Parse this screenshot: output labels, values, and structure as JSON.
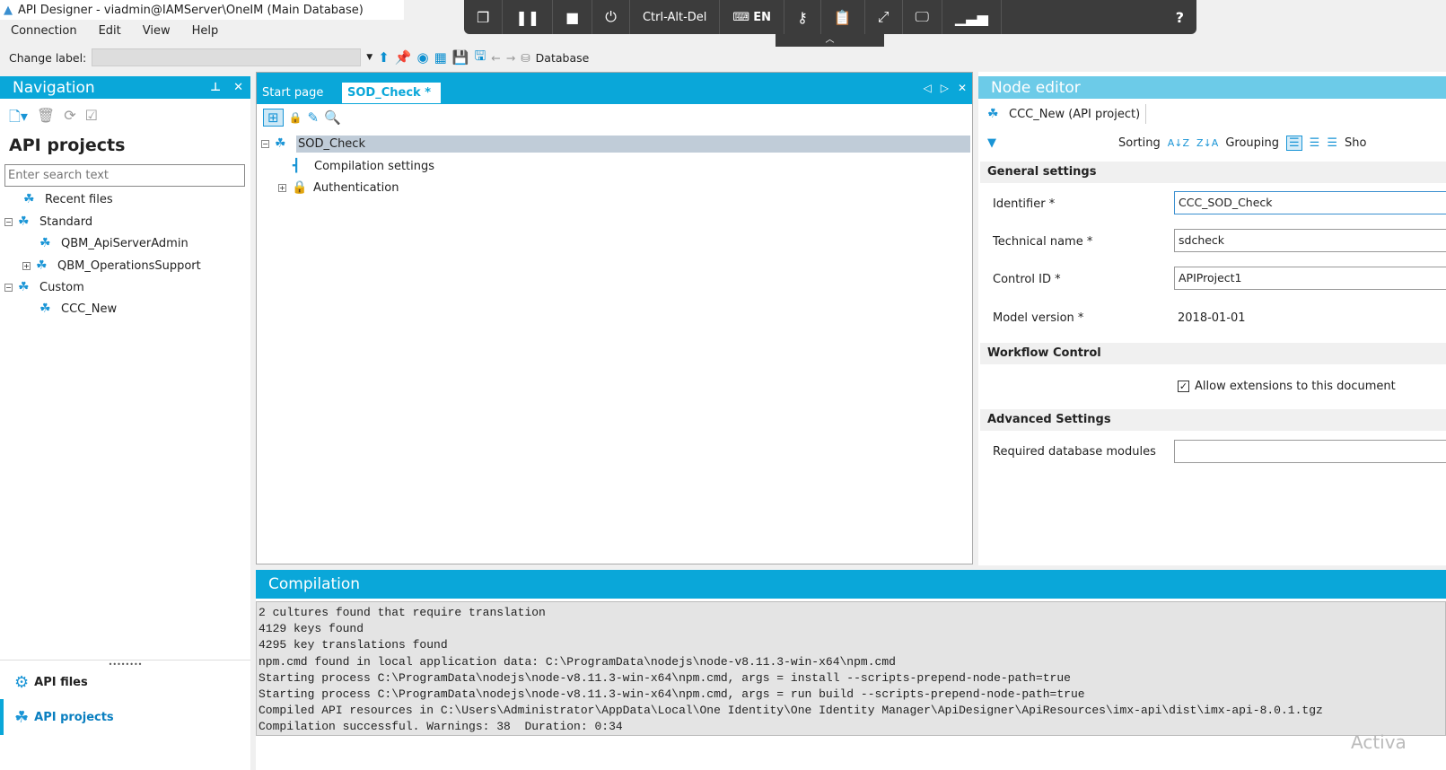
{
  "window": {
    "title": "API Designer - viadmin@IAMServer\\OneIM (Main Database)"
  },
  "menu": [
    "Connection",
    "Edit",
    "View",
    "Help"
  ],
  "toolbar": {
    "change_label": "Change label:",
    "database": "Database"
  },
  "remote": {
    "ctrl_alt_del": "Ctrl-Alt-Del",
    "lang": "EN",
    "help": "?"
  },
  "navigation": {
    "title": "Navigation",
    "section": "API projects",
    "search_placeholder": "Enter search text",
    "tree": [
      "Recent files",
      "Standard",
      "QBM_ApiServerAdmin",
      "QBM_OperationsSupport",
      "Custom",
      "CCC_New"
    ],
    "bottom": [
      "API files",
      "API projects"
    ]
  },
  "document": {
    "tabs": [
      "Start page",
      "SOD_Check *"
    ],
    "tree": [
      "SOD_Check",
      "Compilation settings",
      "Authentication"
    ]
  },
  "node_editor": {
    "title": "Node editor",
    "tab": "CCC_New (API project)",
    "sorting": "Sorting",
    "grouping": "Grouping",
    "show": "Sho",
    "sections": {
      "general": "General settings",
      "workflow": "Workflow Control",
      "advanced": "Advanced Settings"
    },
    "fields": {
      "identifier_label": "Identifier *",
      "identifier": "CCC_SOD_Check",
      "technical_label": "Technical name *",
      "technical": "sdcheck",
      "control_label": "Control ID *",
      "control": "APIProject1",
      "model_label": "Model version *",
      "model": "2018-01-01",
      "modules_label": "Required database modules",
      "modules": ""
    },
    "allow_extensions": "Allow extensions to this document",
    "allow_extensions_checked": true
  },
  "compilation": {
    "title": "Compilation",
    "log": "2 cultures found that require translation\n4129 keys found\n4295 key translations found\nnpm.cmd found in local application data: C:\\ProgramData\\nodejs\\node-v8.11.3-win-x64\\npm.cmd\nStarting process C:\\ProgramData\\nodejs\\node-v8.11.3-win-x64\\npm.cmd, args = install --scripts-prepend-node-path=true\nStarting process C:\\ProgramData\\nodejs\\node-v8.11.3-win-x64\\npm.cmd, args = run build --scripts-prepend-node-path=true\nCompiled API resources in C:\\Users\\Administrator\\AppData\\Local\\One Identity\\One Identity Manager\\ApiDesigner\\ApiResources\\imx-api\\dist\\imx-api-8.0.1.tgz\nCompilation successful. Warnings: 38  Duration: 0:34"
  },
  "watermark": "Activa"
}
